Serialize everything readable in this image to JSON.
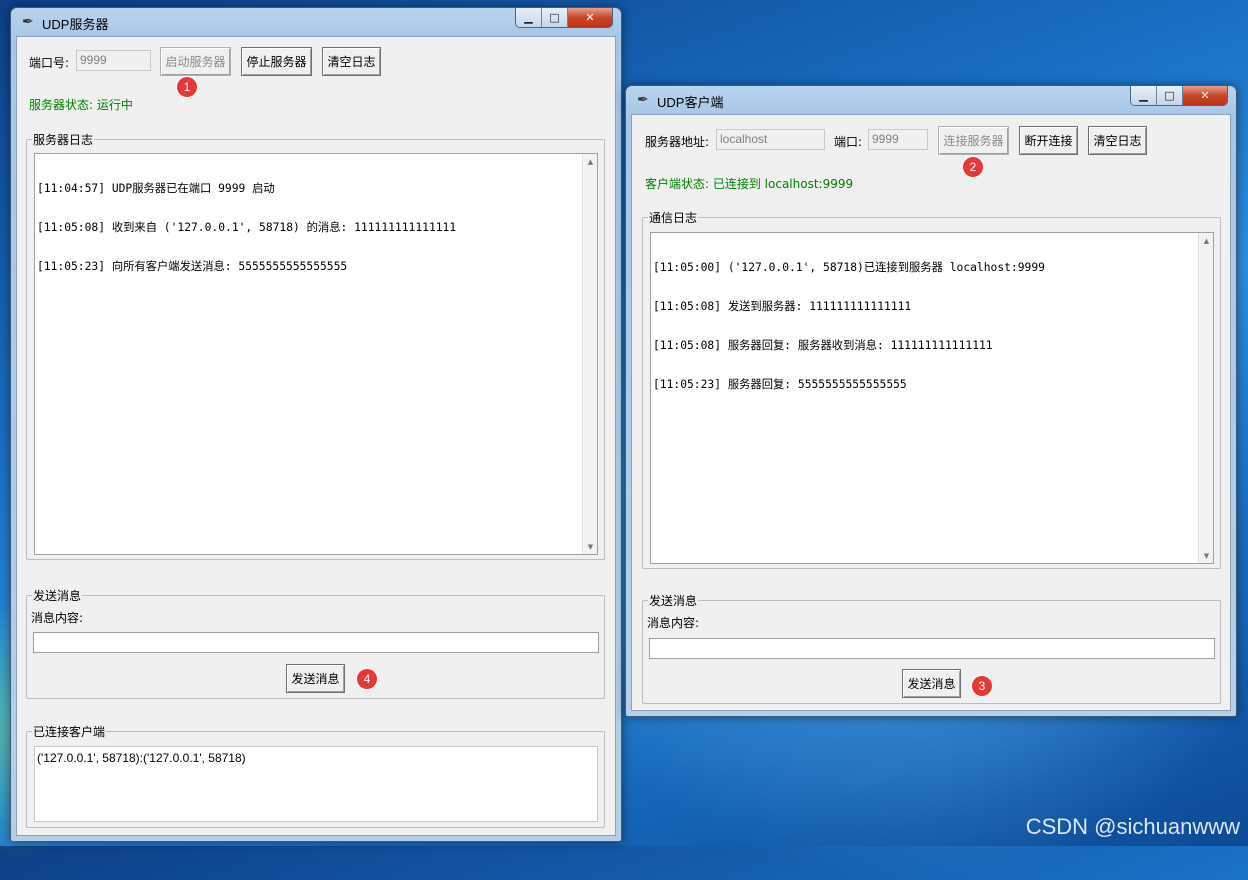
{
  "server": {
    "title": "UDP服务器",
    "port_label": "端口号:",
    "port_value": "9999",
    "start_label": "启动服务器",
    "stop_label": "停止服务器",
    "clear_label": "清空日志",
    "status_text": "服务器状态: 运行中",
    "log_frame_label": "服务器日志",
    "log_lines": [
      "[11:04:57] UDP服务器已在端口 9999 启动",
      "[11:05:08] 收到来自 ('127.0.0.1', 58718) 的消息: 111111111111111",
      "[11:05:23] 向所有客户端发送消息: 5555555555555555"
    ],
    "send_frame_label": "发送消息",
    "msg_label": "消息内容:",
    "msg_value": "",
    "send_button_label": "发送消息",
    "clients_frame_label": "已连接客户端",
    "clients_text": "('127.0.0.1', 58718):('127.0.0.1', 58718)"
  },
  "client": {
    "title": "UDP客户端",
    "addr_label": "服务器地址:",
    "addr_value": "localhost",
    "port_label": "端口:",
    "port_value": "9999",
    "connect_label": "连接服务器",
    "disconnect_label": "断开连接",
    "clear_label": "清空日志",
    "status_text": "客户端状态: 已连接到 localhost:9999",
    "log_frame_label": "通信日志",
    "log_lines": [
      "[11:05:00] ('127.0.0.1', 58718)已连接到服务器 localhost:9999",
      "[11:05:08] 发送到服务器: 111111111111111",
      "[11:05:08] 服务器回复: 服务器收到消息: 111111111111111",
      "[11:05:23] 服务器回复: 5555555555555555"
    ],
    "send_frame_label": "发送消息",
    "msg_label": "消息内容:",
    "msg_value": "",
    "send_button_label": "发送消息"
  },
  "annotations": [
    "1",
    "2",
    "3",
    "4"
  ],
  "watermark": "CSDN @sichuanwww",
  "icons": {
    "app": "feather-icon",
    "minimize": "minimize-icon",
    "maximize": "maximize-icon",
    "close": "close-icon"
  },
  "colors": {
    "status_green": "#008000",
    "marker_red": "#e53935"
  }
}
